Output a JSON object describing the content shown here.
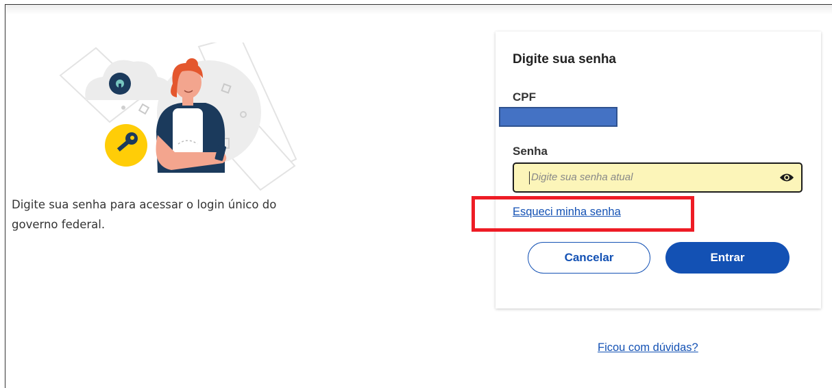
{
  "intro": {
    "line1": "Digite sua senha para acessar o login único do",
    "line2": "governo federal."
  },
  "card": {
    "title": "Digite sua senha",
    "cpf_label": "CPF",
    "password_label": "Senha",
    "password_placeholder": "Digite sua senha atual",
    "forgot_link": "Esqueci minha senha",
    "cancel_label": "Cancelar",
    "enter_label": "Entrar"
  },
  "help_link": "Ficou com dúvidas?",
  "colors": {
    "primary": "#1351b4",
    "input_bg": "#fcf5b9",
    "highlight": "#ee1c25",
    "redaction": "#4472c4",
    "key_badge": "#ffcd07"
  },
  "icons": {
    "password_toggle": "eye-icon",
    "illustration": "person-with-key-illustration"
  }
}
